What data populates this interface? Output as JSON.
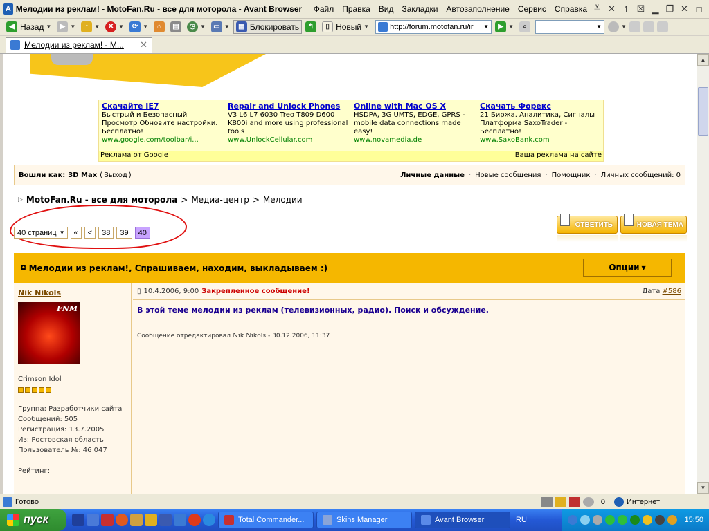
{
  "window": {
    "title": "Мелодии из реклам! - MotoFan.Ru - все для моторола - Avant Browser",
    "menu": [
      "Файл",
      "Правка",
      "Вид",
      "Закладки",
      "Автозаполнение",
      "Сервис",
      "Справка"
    ]
  },
  "toolbar": {
    "back": "Назад",
    "block": "Блокировать",
    "new": "Новый",
    "url": "http://forum.motofan.ru/ir"
  },
  "tab": {
    "title": "Мелодии из реклам! - M..."
  },
  "ads": {
    "items": [
      {
        "title": "Скачайте IE7",
        "body": "Быстрый и Безопасный Просмотр Обновите настройки. Бесплатно!",
        "url": "www.google.com/toolbar/i..."
      },
      {
        "title": "Repair and Unlock Phones",
        "body": "V3 L6 L7 6030 Treo T809 D600 K800i and more using professional tools",
        "url": "www.UnlockCellular.com"
      },
      {
        "title": "Online with Mac OS X",
        "body": "HSDPA, 3G UMTS, EDGE, GPRS - mobile data connections made easy!",
        "url": "www.novamedia.de"
      },
      {
        "title": "Скачать Форекс",
        "body": "21 Биржа. Аналитика, Сигналы Платформа SaxoTrader - Бесплатно!",
        "url": "www.SaxoBank.com"
      }
    ],
    "footer_left": "Реклама от Google",
    "footer_right": "Ваша реклама на сайте"
  },
  "userbar": {
    "logged_label": "Вошли как:",
    "user": "3D Max",
    "logout": "Выход",
    "links": [
      "Личные данные",
      "Новые сообщения",
      "Помощник",
      "Личных сообщений: 0"
    ]
  },
  "breadcrumb": {
    "items": [
      "MotoFan.Ru - все для моторола",
      "Медиа-центр",
      "Мелодии"
    ],
    "sep": ">"
  },
  "pager": {
    "select": "40 страниц",
    "first": "«",
    "prev": "<",
    "pages": [
      "38",
      "39",
      "40"
    ],
    "current": "40"
  },
  "buttons": {
    "reply": "ОТВЕТИТЬ",
    "newtopic": "НОВАЯ ТЕМА"
  },
  "topic": {
    "title": "Мелодии из реклам!, Спрашиваем, находим, выкладываем :)",
    "options": "Опции"
  },
  "post": {
    "author": "Nik Nikols",
    "avatar_text": "FNM",
    "rank": "Crimson Idol",
    "group": "Группа: Разработчики сайта",
    "messages": "Сообщений: 505",
    "registered": "Регистрация: 13.7.2005",
    "from": "Из: Ростовская область",
    "user_no": "Пользователь №: 46 047",
    "rating": "Рейтинг:",
    "datetime": "10.4.2006, 9:00",
    "pinned": "Закрепленное сообщение!",
    "date_label": "Дата",
    "post_no": "#586",
    "text": "В этой теме мелодии из реклам (телевизионных, радио). Поиск и обсуждение.",
    "edited_prefix": "Сообщение отредактировал",
    "edited_by": "Nik Nikols",
    "edited_at": "- 30.12.2006, 11:37"
  },
  "status": {
    "text": "Готово",
    "count": "0",
    "zone": "Интернет"
  },
  "taskbar": {
    "start": "пуск",
    "tasks": [
      "Total Commander...",
      "Skins Manager",
      "Avant Browser"
    ],
    "lang": "RU",
    "time": "15:50"
  }
}
